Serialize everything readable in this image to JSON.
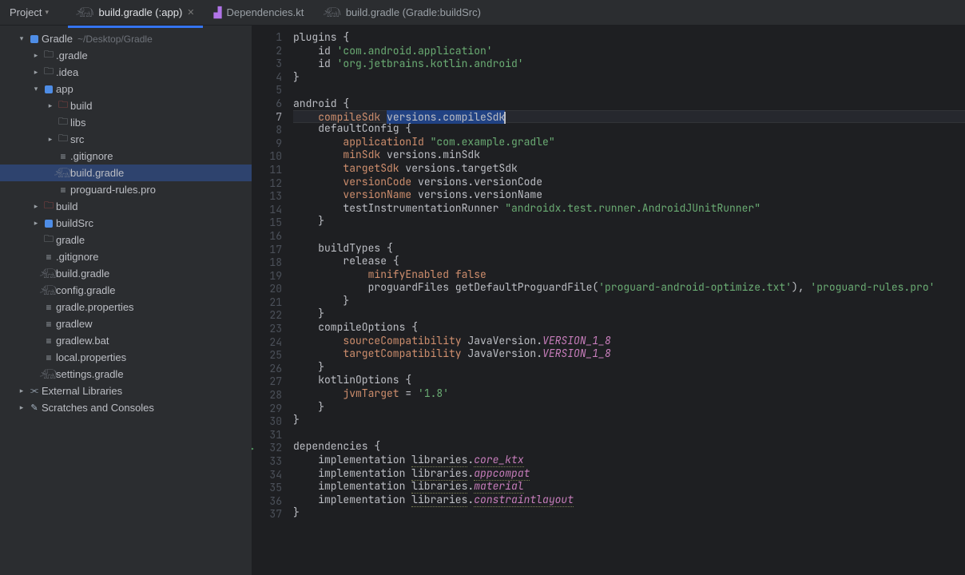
{
  "header": {
    "project_label": "Project"
  },
  "tabs": [
    {
      "icon": "elephant",
      "label": "build.gradle (:app)",
      "active": true,
      "closable": true
    },
    {
      "icon": "kotlin",
      "label": "Dependencies.kt",
      "active": false,
      "closable": false
    },
    {
      "icon": "elephant",
      "label": "build.gradle (Gradle:buildSrc)",
      "active": false,
      "closable": false
    }
  ],
  "tree": [
    {
      "depth": 0,
      "arrow": "down",
      "icon": "module",
      "label": "Gradle",
      "path": "~/Desktop/Gradle"
    },
    {
      "depth": 1,
      "arrow": "right",
      "icon": "folder",
      "label": ".gradle"
    },
    {
      "depth": 1,
      "arrow": "right",
      "icon": "folder",
      "label": ".idea"
    },
    {
      "depth": 1,
      "arrow": "down",
      "icon": "module",
      "label": "app"
    },
    {
      "depth": 2,
      "arrow": "right",
      "icon": "folder-red",
      "label": "build"
    },
    {
      "depth": 2,
      "arrow": "none",
      "icon": "folder",
      "label": "libs"
    },
    {
      "depth": 2,
      "arrow": "right",
      "icon": "folder",
      "label": "src"
    },
    {
      "depth": 2,
      "arrow": "none",
      "icon": "file",
      "label": ".gitignore"
    },
    {
      "depth": 2,
      "arrow": "none",
      "icon": "elephant",
      "label": "build.gradle",
      "selected": true
    },
    {
      "depth": 2,
      "arrow": "none",
      "icon": "file",
      "label": "proguard-rules.pro"
    },
    {
      "depth": 1,
      "arrow": "right",
      "icon": "folder-red",
      "label": "build"
    },
    {
      "depth": 1,
      "arrow": "right",
      "icon": "module",
      "label": "buildSrc"
    },
    {
      "depth": 1,
      "arrow": "none",
      "icon": "folder",
      "label": "gradle"
    },
    {
      "depth": 1,
      "arrow": "none",
      "icon": "file",
      "label": ".gitignore"
    },
    {
      "depth": 1,
      "arrow": "none",
      "icon": "elephant",
      "label": "build.gradle"
    },
    {
      "depth": 1,
      "arrow": "none",
      "icon": "elephant",
      "label": "config.gradle"
    },
    {
      "depth": 1,
      "arrow": "none",
      "icon": "file",
      "label": "gradle.properties"
    },
    {
      "depth": 1,
      "arrow": "none",
      "icon": "file",
      "label": "gradlew"
    },
    {
      "depth": 1,
      "arrow": "none",
      "icon": "file",
      "label": "gradlew.bat"
    },
    {
      "depth": 1,
      "arrow": "none",
      "icon": "file",
      "label": "local.properties"
    },
    {
      "depth": 1,
      "arrow": "none",
      "icon": "elephant",
      "label": "settings.gradle"
    },
    {
      "depth": 0,
      "arrow": "right",
      "icon": "lib",
      "label": "External Libraries"
    },
    {
      "depth": 0,
      "arrow": "right",
      "icon": "scratch",
      "label": "Scratches and Consoles"
    }
  ],
  "editor": {
    "current_line": 7,
    "selection_line": 7,
    "lines": [
      {
        "n": 1,
        "tokens": [
          [
            "ident",
            "plugins "
          ],
          [
            "ident",
            "{"
          ]
        ]
      },
      {
        "n": 2,
        "tokens": [
          [
            "ident",
            "    id "
          ],
          [
            "string",
            "'com.android.application'"
          ]
        ]
      },
      {
        "n": 3,
        "tokens": [
          [
            "ident",
            "    id "
          ],
          [
            "string",
            "'org.jetbrains.kotlin.android'"
          ]
        ]
      },
      {
        "n": 4,
        "tokens": [
          [
            "ident",
            "}"
          ]
        ]
      },
      {
        "n": 5,
        "tokens": []
      },
      {
        "n": 6,
        "tokens": [
          [
            "ident",
            "android "
          ],
          [
            "ident",
            "{"
          ]
        ]
      },
      {
        "n": 7,
        "tokens": [
          [
            "ident",
            "    "
          ],
          [
            "key",
            "compileSdk"
          ],
          [
            "ident",
            " "
          ],
          [
            "sel",
            "versions.compileSdk"
          ],
          [
            "caret",
            ""
          ]
        ]
      },
      {
        "n": 8,
        "tokens": [
          [
            "ident",
            "    defaultConfig "
          ],
          [
            "ident",
            "{"
          ]
        ]
      },
      {
        "n": 9,
        "tokens": [
          [
            "ident",
            "        "
          ],
          [
            "key",
            "applicationId"
          ],
          [
            "ident",
            " "
          ],
          [
            "string",
            "\"com.example.gradle\""
          ]
        ]
      },
      {
        "n": 10,
        "tokens": [
          [
            "ident",
            "        "
          ],
          [
            "key",
            "minSdk"
          ],
          [
            "ident",
            " versions.minSdk"
          ]
        ]
      },
      {
        "n": 11,
        "tokens": [
          [
            "ident",
            "        "
          ],
          [
            "key",
            "targetSdk"
          ],
          [
            "ident",
            " versions.targetSdk"
          ]
        ]
      },
      {
        "n": 12,
        "tokens": [
          [
            "ident",
            "        "
          ],
          [
            "key",
            "versionCode"
          ],
          [
            "ident",
            " versions.versionCode"
          ]
        ]
      },
      {
        "n": 13,
        "tokens": [
          [
            "ident",
            "        "
          ],
          [
            "key",
            "versionName"
          ],
          [
            "ident",
            " versions.versionName"
          ]
        ]
      },
      {
        "n": 14,
        "tokens": [
          [
            "ident",
            "        testInstrumentationRunner "
          ],
          [
            "string",
            "\"androidx.test.runner.AndroidJUnitRunner\""
          ]
        ]
      },
      {
        "n": 15,
        "tokens": [
          [
            "ident",
            "    }"
          ]
        ]
      },
      {
        "n": 16,
        "tokens": []
      },
      {
        "n": 17,
        "tokens": [
          [
            "ident",
            "    buildTypes "
          ],
          [
            "ident",
            "{"
          ]
        ]
      },
      {
        "n": 18,
        "tokens": [
          [
            "ident",
            "        release "
          ],
          [
            "ident",
            "{"
          ]
        ]
      },
      {
        "n": 19,
        "tokens": [
          [
            "ident",
            "            "
          ],
          [
            "key",
            "minifyEnabled"
          ],
          [
            "ident",
            " "
          ],
          [
            "keyword2",
            "false"
          ]
        ]
      },
      {
        "n": 20,
        "tokens": [
          [
            "ident",
            "            proguardFiles getDefaultProguardFile("
          ],
          [
            "string",
            "'proguard-android-optimize.txt'"
          ],
          [
            "ident",
            "), "
          ],
          [
            "string",
            "'proguard-rules.pro'"
          ]
        ]
      },
      {
        "n": 21,
        "tokens": [
          [
            "ident",
            "        }"
          ]
        ]
      },
      {
        "n": 22,
        "tokens": [
          [
            "ident",
            "    }"
          ]
        ]
      },
      {
        "n": 23,
        "tokens": [
          [
            "ident",
            "    compileOptions "
          ],
          [
            "ident",
            "{"
          ]
        ]
      },
      {
        "n": 24,
        "tokens": [
          [
            "ident",
            "        "
          ],
          [
            "key",
            "sourceCompatibility"
          ],
          [
            "ident",
            " JavaVersion."
          ],
          [
            "const",
            "VERSION_1_8"
          ]
        ]
      },
      {
        "n": 25,
        "tokens": [
          [
            "ident",
            "        "
          ],
          [
            "key",
            "targetCompatibility"
          ],
          [
            "ident",
            " JavaVersion."
          ],
          [
            "const",
            "VERSION_1_8"
          ]
        ]
      },
      {
        "n": 26,
        "tokens": [
          [
            "ident",
            "    }"
          ]
        ]
      },
      {
        "n": 27,
        "tokens": [
          [
            "ident",
            "    kotlinOptions "
          ],
          [
            "ident",
            "{"
          ]
        ]
      },
      {
        "n": 28,
        "tokens": [
          [
            "ident",
            "        "
          ],
          [
            "key",
            "jvmTarget"
          ],
          [
            "ident",
            " = "
          ],
          [
            "string",
            "'1.8'"
          ]
        ]
      },
      {
        "n": 29,
        "tokens": [
          [
            "ident",
            "    }"
          ]
        ]
      },
      {
        "n": 30,
        "tokens": [
          [
            "ident",
            "}"
          ]
        ]
      },
      {
        "n": 31,
        "tokens": []
      },
      {
        "n": 32,
        "run": true,
        "tokens": [
          [
            "ident",
            "dependencies "
          ],
          [
            "ident",
            "{"
          ]
        ]
      },
      {
        "n": 33,
        "tokens": [
          [
            "ident",
            "    implementation "
          ],
          [
            "lib",
            "libraries"
          ],
          [
            "ident",
            "."
          ],
          [
            "libprop",
            "core_ktx"
          ]
        ]
      },
      {
        "n": 34,
        "tokens": [
          [
            "ident",
            "    implementation "
          ],
          [
            "lib",
            "libraries"
          ],
          [
            "ident",
            "."
          ],
          [
            "libprop",
            "appcompat"
          ]
        ]
      },
      {
        "n": 35,
        "tokens": [
          [
            "ident",
            "    implementation "
          ],
          [
            "lib",
            "libraries"
          ],
          [
            "ident",
            "."
          ],
          [
            "libprop",
            "material"
          ]
        ]
      },
      {
        "n": 36,
        "tokens": [
          [
            "ident",
            "    implementation "
          ],
          [
            "lib",
            "libraries"
          ],
          [
            "ident",
            "."
          ],
          [
            "libprop",
            "constraintlayout"
          ]
        ]
      },
      {
        "n": 37,
        "tokens": [
          [
            "ident",
            "}"
          ]
        ]
      }
    ]
  }
}
